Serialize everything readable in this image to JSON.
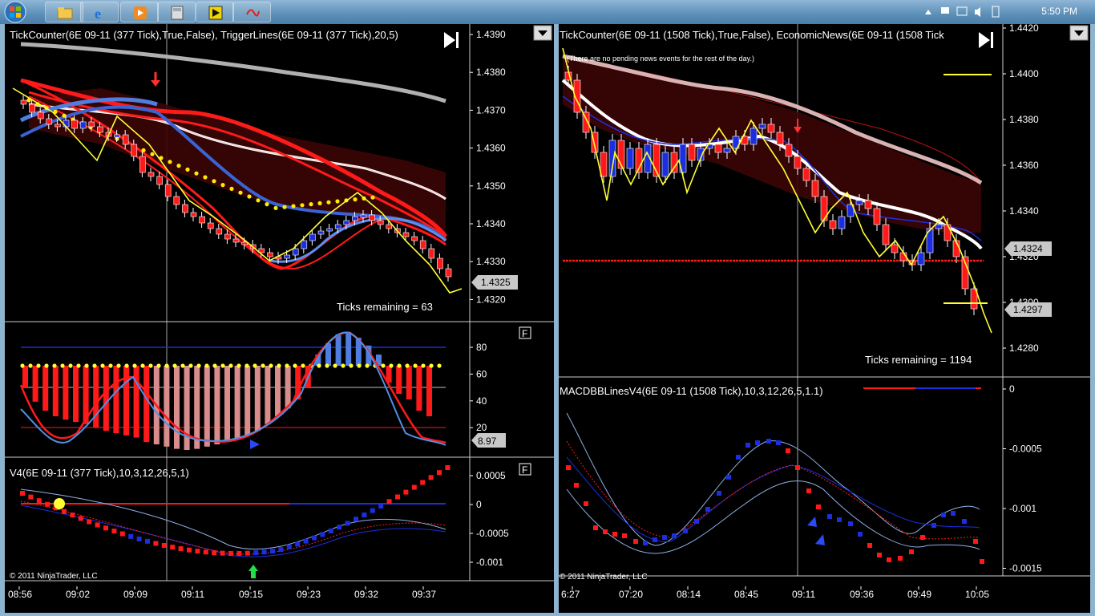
{
  "taskbar": {
    "clock": "5:50 PM",
    "apps": [
      "folder-icon",
      "ie-icon",
      "media-player-icon",
      "calculator-icon",
      "ninjatrader-icon",
      "app-icon"
    ]
  },
  "left": {
    "title": "TickCounter(6E 09-11 (377 Tick),True,False), TriggerLines(6E 09-11 (377 Tick),20,5)",
    "ticks_remaining": "Ticks remaining = 63",
    "price_ticks": [
      "1.4390",
      "1.4380",
      "1.4370",
      "1.4360",
      "1.4350",
      "1.4340",
      "1.4330",
      "1.4320"
    ],
    "price_last": "1.4325",
    "stoch_ticks": [
      "80",
      "60",
      "40",
      "20"
    ],
    "stoch_value": "8.97",
    "stoch_flag": "F",
    "v4_title": "V4(6E 09-11 (377 Tick),10,3,12,26,5,1)",
    "v4_ticks": [
      "0.0005",
      "0",
      "-0.0005",
      "-0.001"
    ],
    "v4_flag": "F",
    "time_ticks": [
      "08:56",
      "09:02",
      "09:09",
      "09:11",
      "09:15",
      "09:23",
      "09:32",
      "09:37"
    ],
    "copyright": "© 2011 NinjaTrader, LLC"
  },
  "right": {
    "title": "TickCounter(6E 09-11 (1508 Tick),True,False), EconomicNews(6E 09-11 (1508 Tick",
    "news_text": "(There are no pending news events for the rest of the day.)",
    "ticks_remaining": "Ticks remaining = 1194",
    "price_ticks": [
      "1.4420",
      "1.4400",
      "1.4380",
      "1.4360",
      "1.4340",
      "1.4320",
      "1.4300",
      "1.4280"
    ],
    "price_label_a": "1.4324",
    "price_label_b": "1.4297",
    "macd_title": "MACDBBLinesV4(6E 09-11 (1508 Tick),10,3,12,26,5,1.1)",
    "macd_ticks": [
      "0",
      "-0.0005",
      "-0.001",
      "-0.0015"
    ],
    "time_ticks": [
      "6:27",
      "07:20",
      "08:14",
      "08:45",
      "09:11",
      "09:36",
      "09:49",
      "10:05"
    ],
    "copyright": "© 2011 NinjaTrader, LLC"
  },
  "colors": {
    "bull": "#1c2ee0",
    "bear": "#ff1a1a",
    "trigger": "#ffff33",
    "bg": "#000000"
  }
}
